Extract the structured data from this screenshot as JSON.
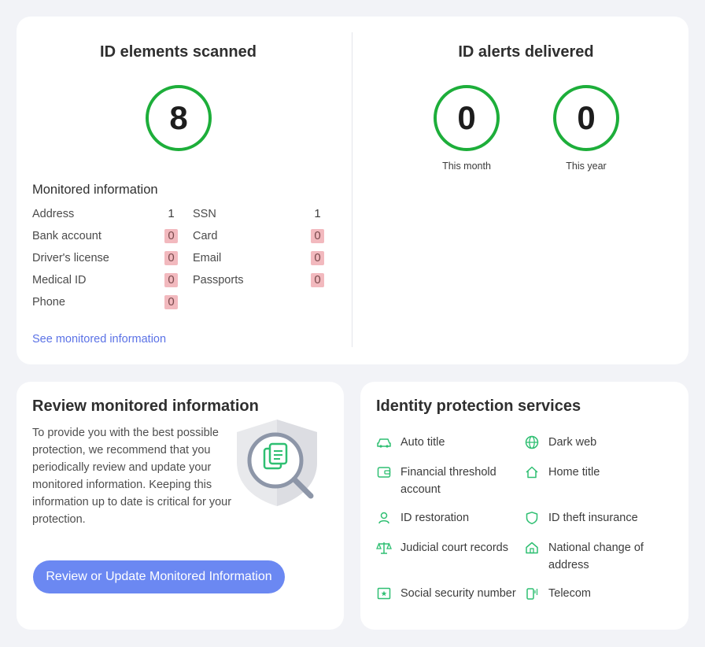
{
  "scanned": {
    "title": "ID elements scanned",
    "count": "8",
    "monitored_title": "Monitored information",
    "items": [
      {
        "label": "Address",
        "value": "1"
      },
      {
        "label": "SSN",
        "value": "1"
      },
      {
        "label": "Bank account",
        "value": "0"
      },
      {
        "label": "Card",
        "value": "0"
      },
      {
        "label": "Driver's license",
        "value": "0"
      },
      {
        "label": "Email",
        "value": "0"
      },
      {
        "label": "Medical ID",
        "value": "0"
      },
      {
        "label": "Passports",
        "value": "0"
      },
      {
        "label": "Phone",
        "value": "0"
      }
    ],
    "link": "See monitored information"
  },
  "alerts": {
    "title": "ID alerts delivered",
    "month_value": "0",
    "month_label": "This month",
    "year_value": "0",
    "year_label": "This year"
  },
  "review": {
    "title": "Review monitored information",
    "text": "To provide you with the best possible protection, we recommend that you periodically review and update your monitored information. Keeping this information up to date is critical for your protection.",
    "button": "Review or Update Monitored Information"
  },
  "services": {
    "title": "Identity protection services",
    "items": [
      {
        "label": "Auto title",
        "icon": "car-icon"
      },
      {
        "label": "Dark web",
        "icon": "globe-icon"
      },
      {
        "label": "Financial threshold account",
        "icon": "wallet-icon"
      },
      {
        "label": "Home title",
        "icon": "home-icon"
      },
      {
        "label": "ID restoration",
        "icon": "person-icon"
      },
      {
        "label": "ID theft insurance",
        "icon": "shield-icon"
      },
      {
        "label": "Judicial court records",
        "icon": "scales-icon"
      },
      {
        "label": "National change of address",
        "icon": "house-door-icon"
      },
      {
        "label": "Social security number",
        "icon": "id-card-icon"
      },
      {
        "label": "Telecom",
        "icon": "phone-icon"
      }
    ]
  },
  "colors": {
    "ring": "#1dae3a",
    "zero_badge": "#f2b9be",
    "link": "#5b72e6",
    "button": "#6b88f2",
    "service_icon": "#2fbf72"
  }
}
